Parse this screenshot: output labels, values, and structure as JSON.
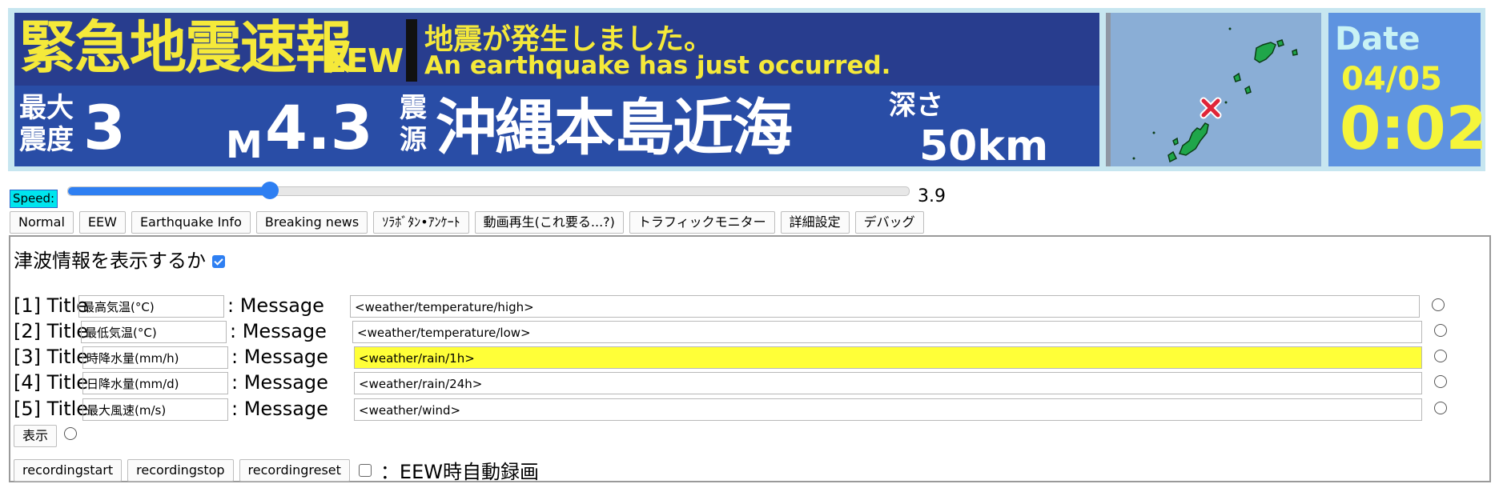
{
  "banner": {
    "title": "緊急地震速報",
    "badge": "EEW",
    "message_ja": "地震が発生しました。",
    "message_en": "An earthquake has just occurred.",
    "shindo_label": "最大震度",
    "shindo_value": "3",
    "magnitude_label": "M",
    "magnitude_value": "4.3",
    "hypocenter_label": "震源",
    "hypocenter_value": "沖縄本島近海",
    "depth_label": "深さ",
    "depth_value": "50km"
  },
  "date_panel": {
    "label": "Date",
    "date": "04/05",
    "time": "0:02"
  },
  "speed": {
    "label": "Speed:",
    "value": "3.9",
    "fraction": 0.24
  },
  "mode_buttons": [
    "Normal",
    "EEW",
    "Earthquake Info",
    "Breaking news",
    "ｿﾗﾎﾞﾀﾝ•ｱﾝｹｰﾄ",
    "動画再生(これ要る...?)",
    "トラフィックモニター",
    "詳細設定",
    "デバッグ"
  ],
  "panel": {
    "tsunami_label": "津波情報を表示するか",
    "tsunami_checked": true,
    "rows": [
      {
        "label": "[1] Title",
        "title": "最高気温(°C)",
        "colon": ": Message",
        "message": "<weather/temperature/high>"
      },
      {
        "label": "[2] Title",
        "title": "最低気温(°C)",
        "colon": ": Message",
        "message": "<weather/temperature/low>"
      },
      {
        "label": "[3] Title",
        "title": "時降水量(mm/h)",
        "colon": ": Message",
        "message": "<weather/rain/1h>",
        "highlight": true
      },
      {
        "label": "[4] Title",
        "title": "日降水量(mm/d)",
        "colon": ": Message",
        "message": "<weather/rain/24h>"
      },
      {
        "label": "[5] Title",
        "title": "最大風速(m/s)",
        "colon": ": Message",
        "message": "<weather/wind>"
      }
    ],
    "show_button": "表示",
    "recording_buttons": [
      "recordingstart",
      "recordingstop",
      "recordingreset"
    ],
    "auto_record_label": "：EEW時自動録画"
  },
  "colors": {
    "banner_blue": "#294da6",
    "banner_top": "#283d8e",
    "accent_yellow": "#f5e93a",
    "highlight": "#ffff38",
    "slider": "#2e7ff2"
  }
}
